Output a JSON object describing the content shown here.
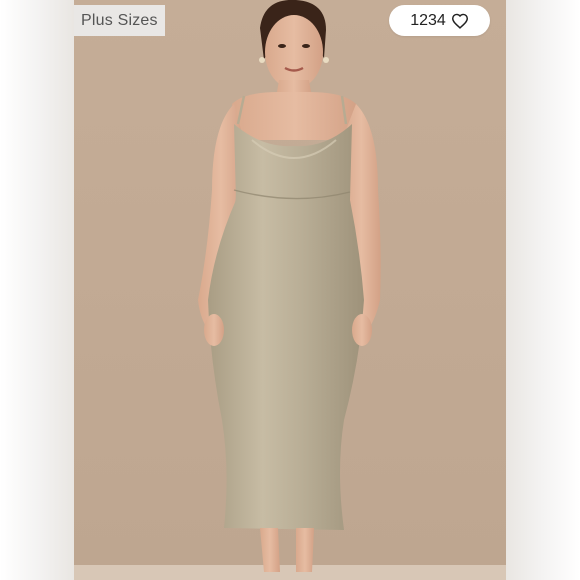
{
  "listing_photo": {
    "badge": "Plus Sizes",
    "likes": {
      "count": "1234",
      "icon": "heart-outline-icon"
    }
  },
  "colors": {
    "backdrop": "#c3ab95",
    "dress": "#b8ad95",
    "badge_background": "#ececec",
    "like_pill_background": "#ffffff"
  }
}
